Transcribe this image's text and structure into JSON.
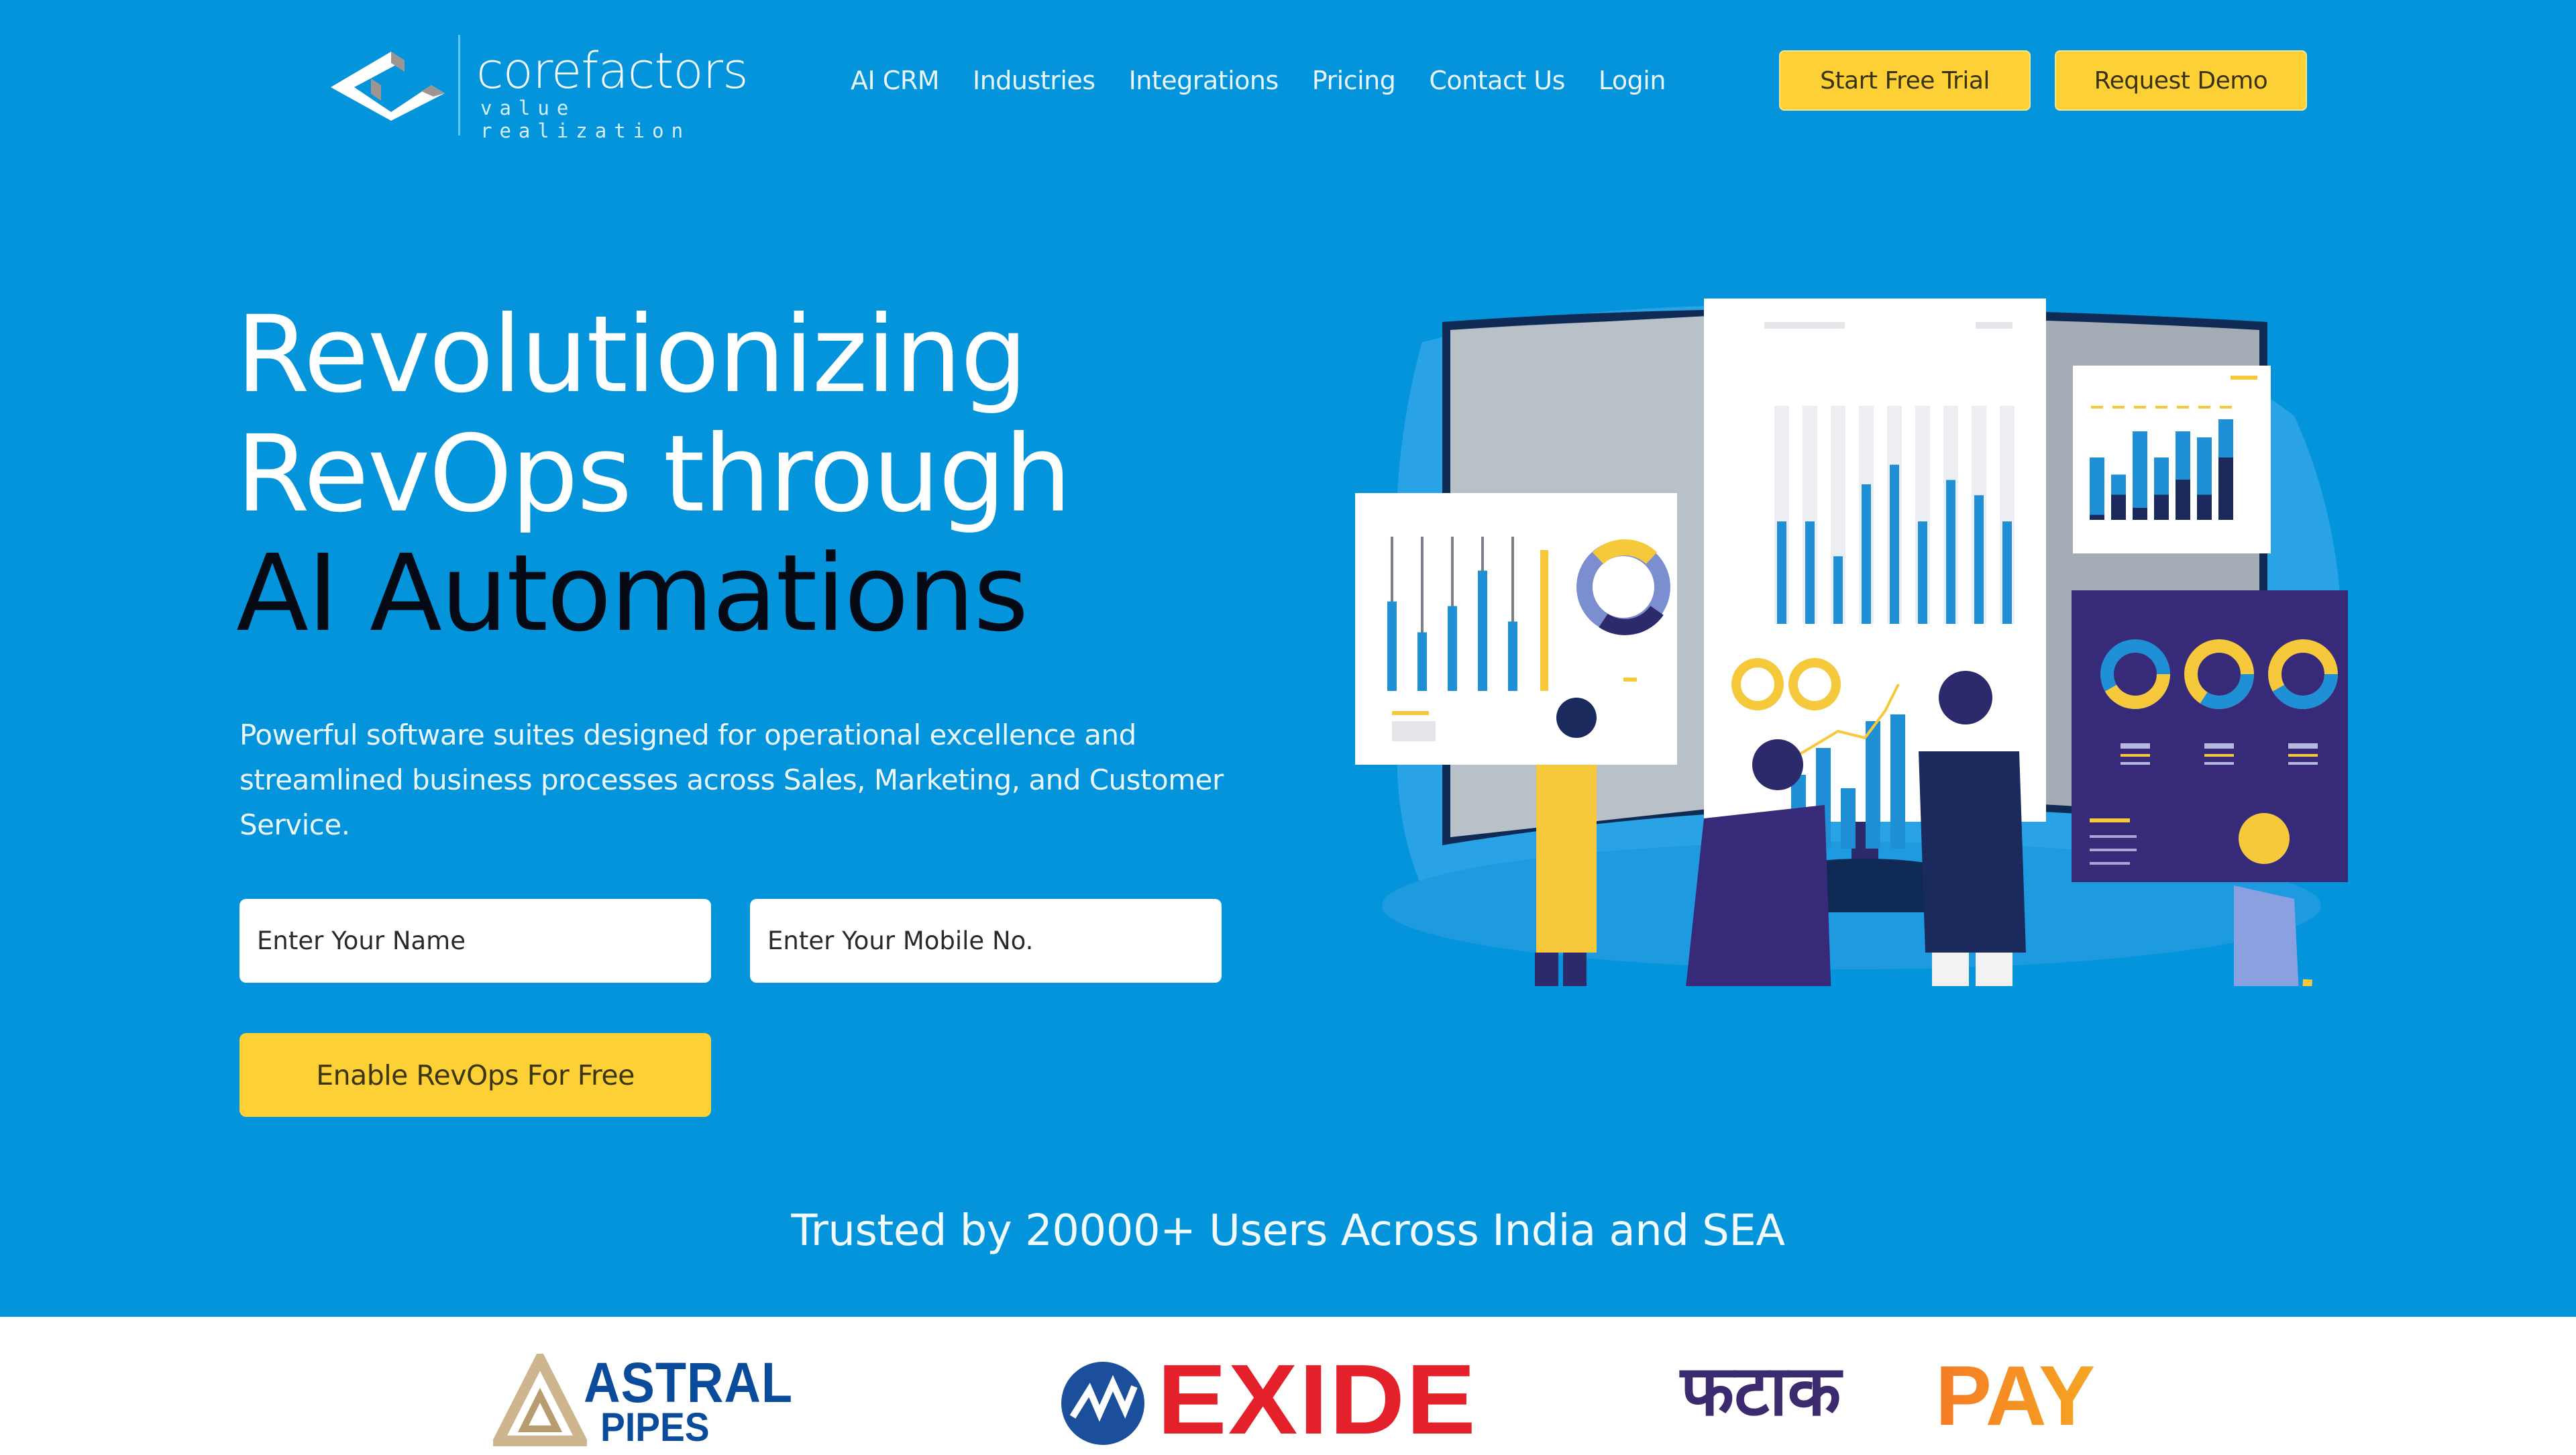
{
  "header": {
    "logo": {
      "name": "corefactors",
      "tagline": "value realization",
      "icon": "corefactors-logo-mark"
    },
    "nav": [
      {
        "label": "AI CRM"
      },
      {
        "label": "Industries"
      },
      {
        "label": "Integrations"
      },
      {
        "label": "Pricing"
      },
      {
        "label": "Contact Us"
      },
      {
        "label": "Login"
      }
    ],
    "start_trial_label": "Start Free Trial",
    "request_demo_label": "Request Demo"
  },
  "hero": {
    "headline_line1": "Revolutionizing",
    "headline_line2": "RevOps through",
    "headline_line3": "AI Automations",
    "subtext": "Powerful software suites designed for operational excellence and streamlined business processes across Sales, Marketing, and Customer Service.",
    "form": {
      "name_placeholder": "Enter Your Name",
      "name_value": "",
      "mobile_placeholder": "Enter Your Mobile No.",
      "mobile_value": "",
      "submit_label": "Enable RevOps For Free"
    },
    "illustration": "team-analyzing-dashboards-illustration"
  },
  "trusted": {
    "text": "Trusted by 20000+ Users Across India and SEA"
  },
  "client_logos": [
    {
      "name": "Astral Pipes",
      "line1": "ASTRAL",
      "line2": "PIPES"
    },
    {
      "name": "Exide",
      "text": "EXIDE"
    },
    {
      "name": "FatakPay",
      "hindi": "फटाक",
      "latin": "PAY"
    }
  ],
  "colors": {
    "brand_blue": "#0494dc",
    "cta_yellow": "#fdd035",
    "headline_dark": "#050a14",
    "exide_red": "#e4202a",
    "astral_blue": "#0a4c9b",
    "fatak_purple": "#3b2a6e",
    "fatak_orange": "#f57b24"
  }
}
